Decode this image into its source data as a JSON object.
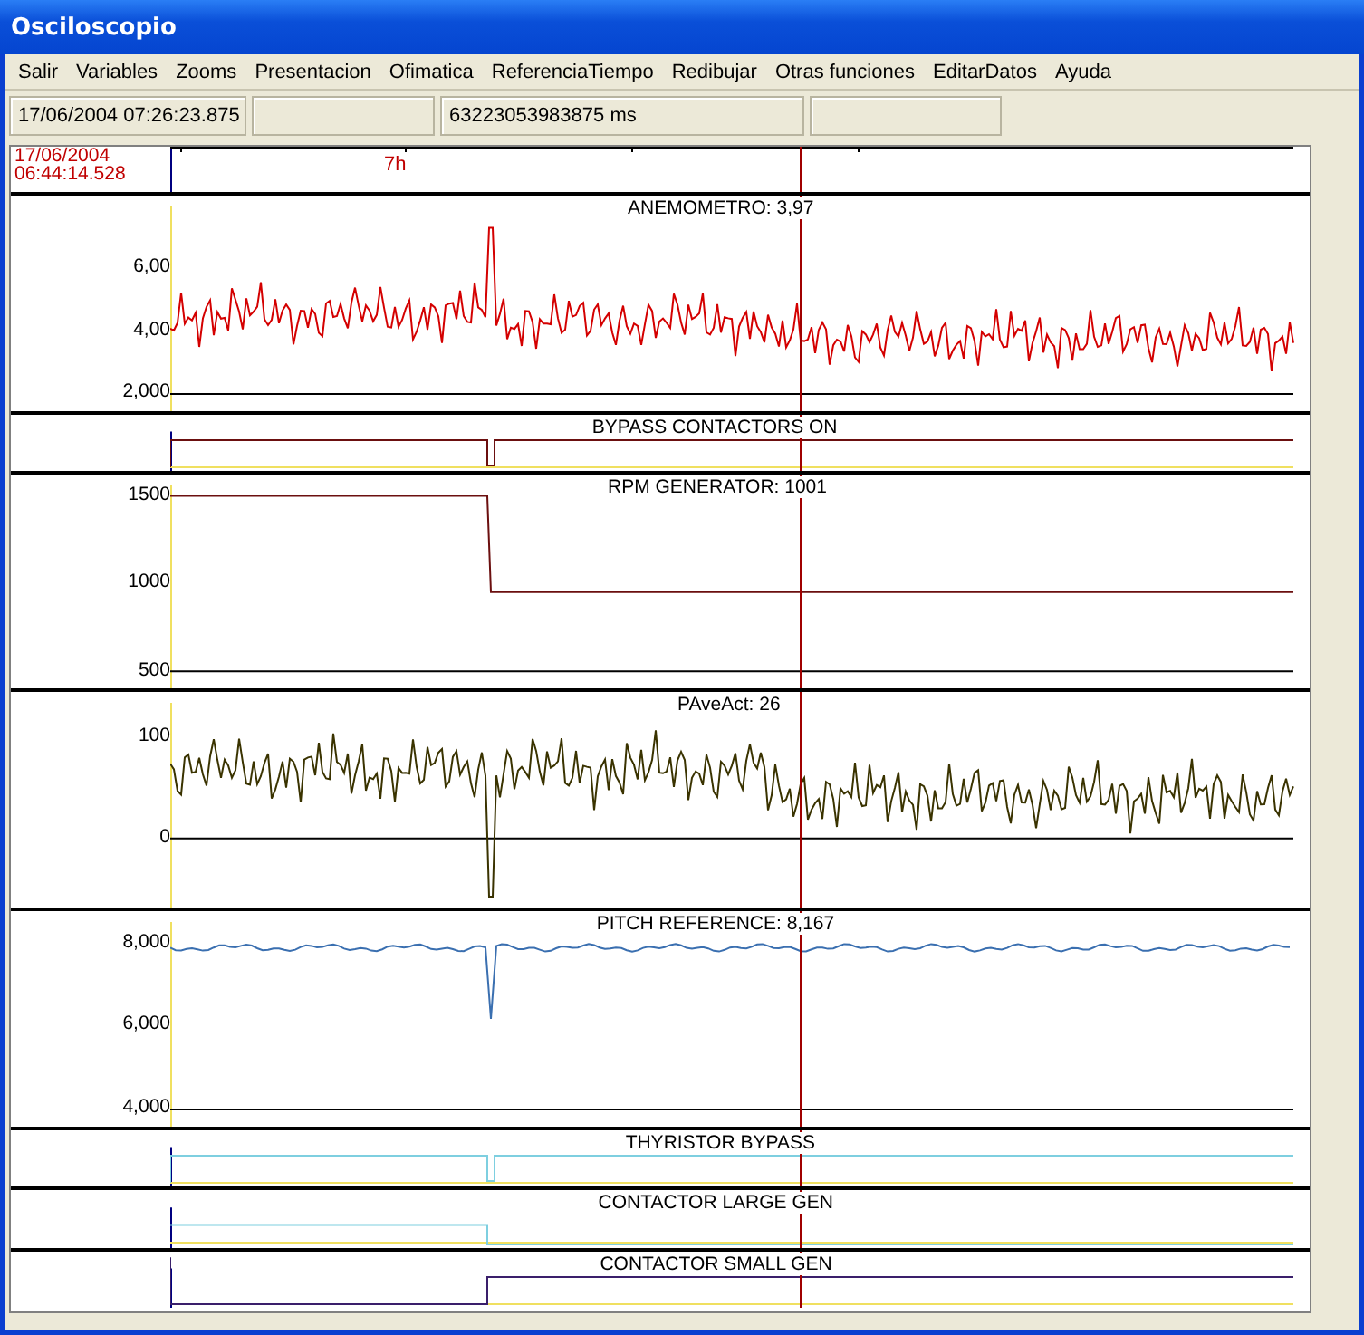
{
  "window": {
    "title": "Osciloscopio"
  },
  "menu": [
    "Salir",
    "Variables",
    "Zooms",
    "Presentacion",
    "Ofimatica",
    "ReferenciaTiempo",
    "Redibujar",
    "Otras funciones",
    "EditarDatos",
    "Ayuda"
  ],
  "status_bar": [
    "17/06/2004 07:26:23.875",
    "63223053983875 ms"
  ],
  "time_axis": {
    "start_date": "17/06/2004",
    "start_time": "06:44:14.528",
    "tick_label": "7h"
  },
  "panels": [
    {
      "kind": "noise",
      "title": "ANEMOMETRO: 3,97",
      "color": "#d40000",
      "ticks": [
        "6,00",
        "4,00",
        "2,000"
      ]
    },
    {
      "kind": "digital",
      "title": "BYPASS CONTACTORS ON",
      "color": "#6b0f0f"
    },
    {
      "kind": "step",
      "title": "RPM GENERATOR: 1001",
      "color": "#6b0f0f",
      "ticks": [
        "1500",
        "1000",
        "500"
      ]
    },
    {
      "kind": "noise",
      "title": "PAveAct: 26",
      "color": "#3a3300",
      "ticks": [
        "100",
        "0"
      ]
    },
    {
      "kind": "level",
      "title": "PITCH REFERENCE: 8,167",
      "color": "#3a6fb0",
      "ticks": [
        "8,000",
        "6,000",
        "4,000"
      ]
    },
    {
      "kind": "digital",
      "title": "THYRISTOR BYPASS",
      "color": "#7ecfe0"
    },
    {
      "kind": "digital-low",
      "title": "CONTACTOR LARGE GEN",
      "color": "#7ecfe0"
    },
    {
      "kind": "digital-rise",
      "title": "CONTACTOR SMALL GEN",
      "color": "#3a1f6b"
    }
  ]
}
